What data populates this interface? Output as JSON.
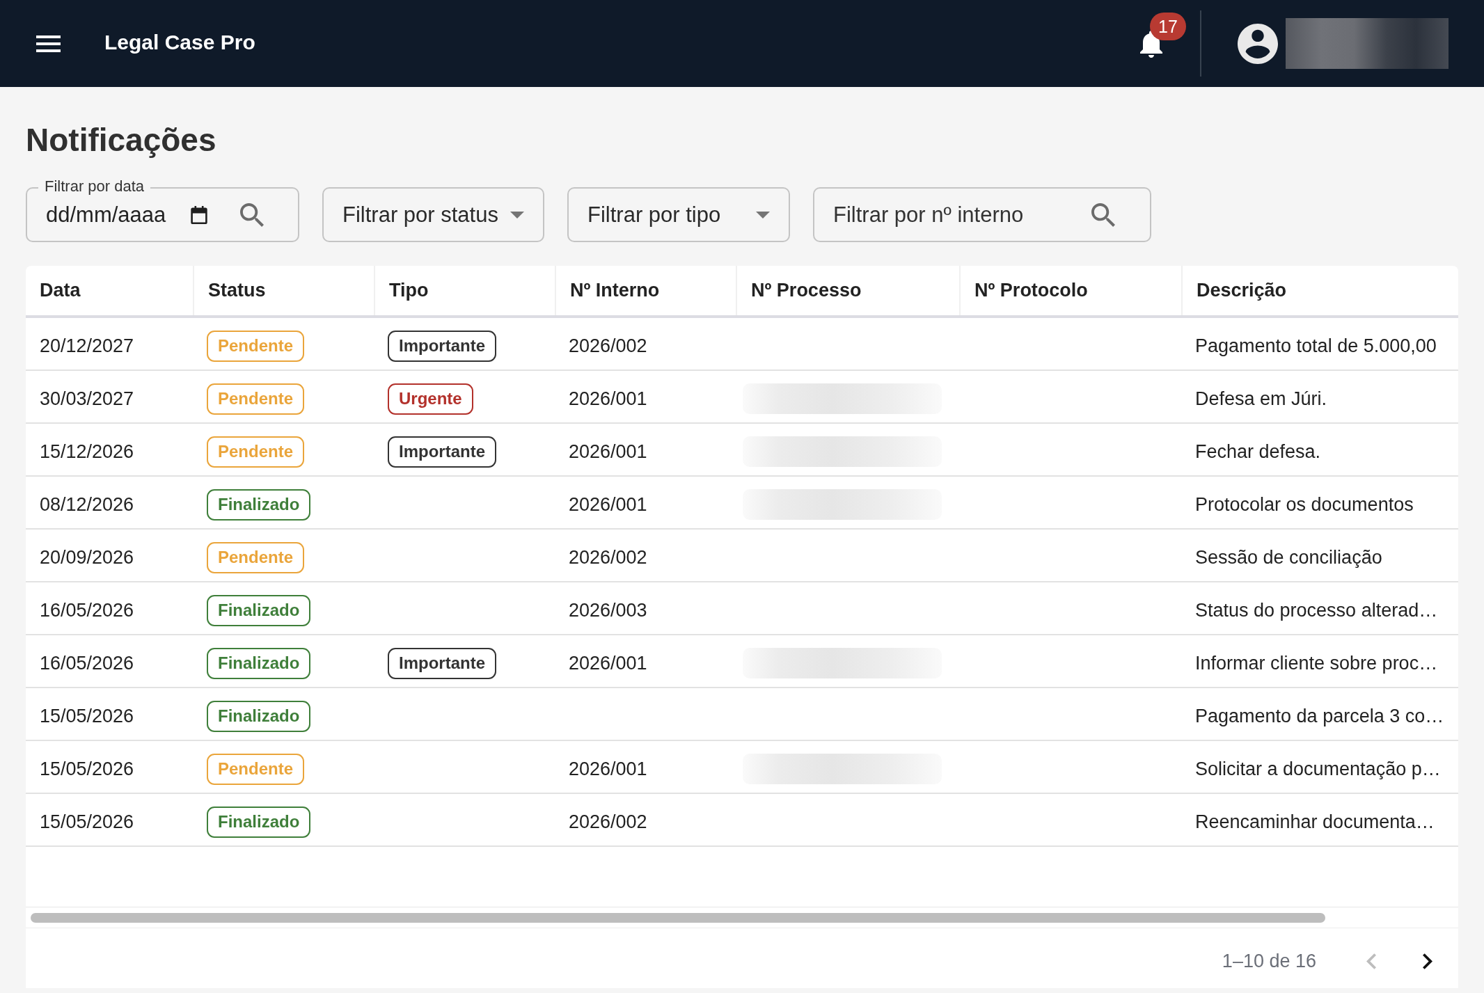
{
  "app_bar": {
    "title": "Legal Case Pro",
    "notification_count": "17"
  },
  "page_title": "Notificações",
  "filters": [
    {
      "kind": "date",
      "label": "Filtrar por data",
      "placeholder": "dd/mm/aaaa"
    },
    {
      "kind": "select",
      "placeholder": "Filtrar por status"
    },
    {
      "kind": "select",
      "placeholder": "Filtrar por tipo"
    },
    {
      "kind": "search",
      "placeholder": "Filtrar por nº interno"
    }
  ],
  "table": {
    "columns": [
      "Data",
      "Status",
      "Tipo",
      "Nº Interno",
      "Nº Processo",
      "Nº Protocolo",
      "Descrição"
    ],
    "rows": [
      {
        "data": "20/12/2027",
        "status": {
          "label": "Pendente",
          "color": "#eaa53b"
        },
        "tipo": {
          "label": "Importante",
          "color": "#333333"
        },
        "interno": "2026/002",
        "processo_blurred": false,
        "descricao": "Pagamento total de 5.000,00"
      },
      {
        "data": "30/03/2027",
        "status": {
          "label": "Pendente",
          "color": "#eaa53b"
        },
        "tipo": {
          "label": "Urgente",
          "color": "#b3312b"
        },
        "interno": "2026/001",
        "processo_blurred": true,
        "descricao": "Defesa em Júri."
      },
      {
        "data": "15/12/2026",
        "status": {
          "label": "Pendente",
          "color": "#eaa53b"
        },
        "tipo": {
          "label": "Importante",
          "color": "#333333"
        },
        "interno": "2026/001",
        "processo_blurred": true,
        "descricao": "Fechar defesa."
      },
      {
        "data": "08/12/2026",
        "status": {
          "label": "Finalizado",
          "color": "#3f7f3a"
        },
        "interno": "2026/001",
        "processo_blurred": true,
        "descricao": "Protocolar os documentos"
      },
      {
        "data": "20/09/2026",
        "status": {
          "label": "Pendente",
          "color": "#eaa53b"
        },
        "interno": "2026/002",
        "processo_blurred": false,
        "descricao": "Sessão de conciliação"
      },
      {
        "data": "16/05/2026",
        "status": {
          "label": "Finalizado",
          "color": "#3f7f3a"
        },
        "interno": "2026/003",
        "processo_blurred": false,
        "descricao": "Status do processo alterad…"
      },
      {
        "data": "16/05/2026",
        "status": {
          "label": "Finalizado",
          "color": "#3f7f3a"
        },
        "tipo": {
          "label": "Importante",
          "color": "#333333"
        },
        "interno": "2026/001",
        "processo_blurred": true,
        "descricao": "Informar cliente sobre proc…"
      },
      {
        "data": "15/05/2026",
        "status": {
          "label": "Finalizado",
          "color": "#3f7f3a"
        },
        "processo_blurred": false,
        "descricao": "Pagamento da parcela 3 co…"
      },
      {
        "data": "15/05/2026",
        "status": {
          "label": "Pendente",
          "color": "#eaa53b"
        },
        "interno": "2026/001",
        "processo_blurred": true,
        "descricao": "Solicitar a documentação p…"
      },
      {
        "data": "15/05/2026",
        "status": {
          "label": "Finalizado",
          "color": "#3f7f3a"
        },
        "interno": "2026/002",
        "processo_blurred": false,
        "descricao": "Reencaminhar documenta…"
      }
    ]
  },
  "pagination": {
    "range": "1–10 de 16",
    "buttons": [
      {
        "kind": "prev",
        "disabled": true
      },
      {
        "kind": "next",
        "disabled": false
      }
    ]
  }
}
